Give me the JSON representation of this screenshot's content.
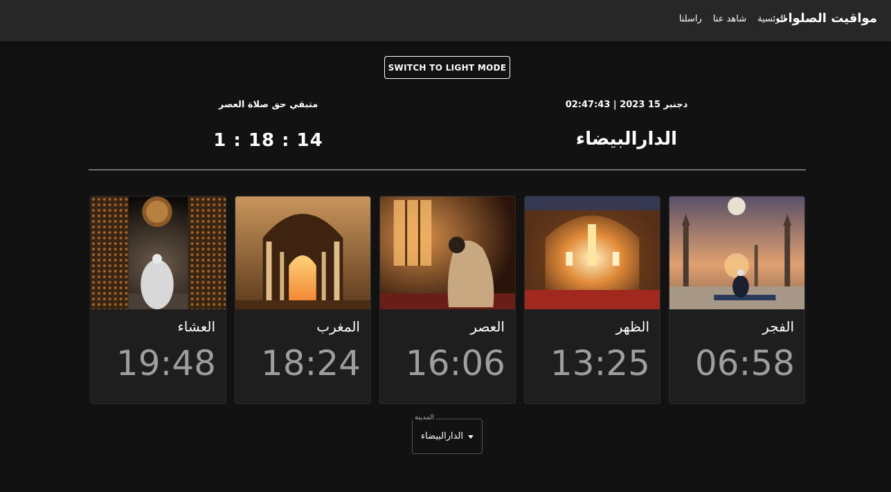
{
  "header": {
    "brand": "مواقيت الصلوات",
    "nav": [
      "الرئسية",
      "شاهد عنا",
      "راسلنا"
    ]
  },
  "mode_button": "SWITCH TO LIGHT MODE",
  "info": {
    "date_time": "دجنبر 15 2023 | 02:47:43",
    "city": "الدارالبيضاء",
    "remaining_label": "متبقي حق صلاة العصر",
    "countdown": "1 : 18 : 14"
  },
  "prayers": [
    {
      "name": "الفجر",
      "time": "06:58",
      "image": "minaret-moon-icon"
    },
    {
      "name": "الظهر",
      "time": "13:25",
      "image": "mosque-arch-sunlight-icon"
    },
    {
      "name": "العصر",
      "time": "16:06",
      "image": "praying-man-window-icon"
    },
    {
      "name": "المغرب",
      "time": "18:24",
      "image": "arch-sunset-icon"
    },
    {
      "name": "العشاء",
      "time": "19:48",
      "image": "praying-man-night-icon"
    }
  ],
  "city_select": {
    "legend": "المدينة",
    "value": "الدارالبيضاء"
  },
  "colors": {
    "background": "#121212",
    "topbar": "#272727",
    "card": "#1e1e1e",
    "time_text": "#9e9e9e"
  }
}
